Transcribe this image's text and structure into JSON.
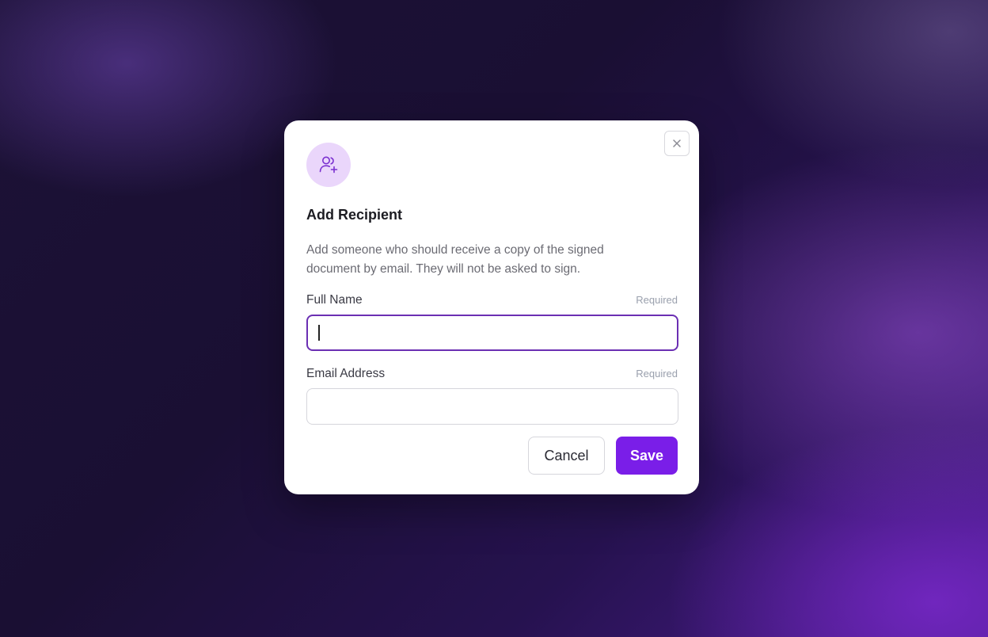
{
  "modal": {
    "title": "Add Recipient",
    "description": "Add someone who should receive a copy of the signed document by email. They will not be asked to sign.",
    "icon": "user-plus-icon",
    "close_icon": "close-icon"
  },
  "fields": {
    "full_name": {
      "label": "Full Name",
      "required": "Required",
      "value": "",
      "placeholder": ""
    },
    "email": {
      "label": "Email Address",
      "required": "Required",
      "value": "",
      "placeholder": ""
    }
  },
  "actions": {
    "cancel_label": "Cancel",
    "save_label": "Save"
  },
  "colors": {
    "accent": "#7a1ee8",
    "focus_border": "#6b2fb3",
    "icon_badge_bg": "#ead6fb"
  }
}
